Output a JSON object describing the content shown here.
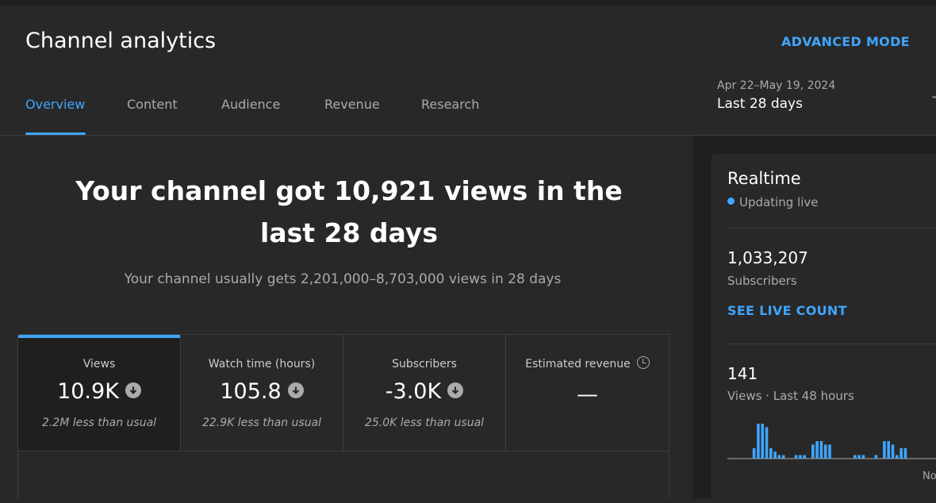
{
  "header": {
    "title": "Channel analytics",
    "advanced_mode": "ADVANCED MODE",
    "tabs": [
      {
        "label": "Overview",
        "active": true
      },
      {
        "label": "Content",
        "active": false
      },
      {
        "label": "Audience",
        "active": false
      },
      {
        "label": "Revenue",
        "active": false
      },
      {
        "label": "Research",
        "active": false
      }
    ],
    "date_range": {
      "dates": "Apr 22–May 19, 2024",
      "period": "Last 28 days"
    }
  },
  "overview": {
    "headline": "Your channel got 10,921 views in the last 28 days",
    "subtext": "Your channel usually gets 2,201,000–8,703,000 views in 28 days"
  },
  "metrics": [
    {
      "label": "Views",
      "value": "10.9K",
      "trend": "down",
      "note": "2.2M less than usual"
    },
    {
      "label": "Watch time (hours)",
      "value": "105.8",
      "trend": "down",
      "note": "22.9K less than usual"
    },
    {
      "label": "Subscribers",
      "value": "-3.0K",
      "trend": "down",
      "note": "25.0K less than usual"
    },
    {
      "label": "Estimated revenue",
      "value": "—",
      "note": ""
    }
  ],
  "realtime": {
    "title": "Realtime",
    "status": "Updating live",
    "subscribers": "1,033,207",
    "subscribers_label": "Subscribers",
    "see_live_count": "SEE LIVE COUNT",
    "views": "141",
    "views_label": "Views · Last 48 hours",
    "axis_label": "No",
    "accent": "#3ea6ff",
    "chart_bars": [
      {
        "hour": 6,
        "value": 3
      },
      {
        "hour": 7,
        "value": 10
      },
      {
        "hour": 8,
        "value": 10
      },
      {
        "hour": 9,
        "value": 9
      },
      {
        "hour": 10,
        "value": 3
      },
      {
        "hour": 11,
        "value": 2
      },
      {
        "hour": 12,
        "value": 1
      },
      {
        "hour": 13,
        "value": 1
      },
      {
        "hour": 16,
        "value": 1
      },
      {
        "hour": 17,
        "value": 1
      },
      {
        "hour": 18,
        "value": 1
      },
      {
        "hour": 20,
        "value": 4
      },
      {
        "hour": 21,
        "value": 5
      },
      {
        "hour": 22,
        "value": 5
      },
      {
        "hour": 23,
        "value": 4
      },
      {
        "hour": 24,
        "value": 4
      },
      {
        "hour": 30,
        "value": 1
      },
      {
        "hour": 31,
        "value": 1
      },
      {
        "hour": 32,
        "value": 1
      },
      {
        "hour": 35,
        "value": 1
      },
      {
        "hour": 37,
        "value": 5
      },
      {
        "hour": 38,
        "value": 5
      },
      {
        "hour": 39,
        "value": 4
      },
      {
        "hour": 40,
        "value": 1
      },
      {
        "hour": 41,
        "value": 3
      },
      {
        "hour": 42,
        "value": 3
      }
    ]
  }
}
